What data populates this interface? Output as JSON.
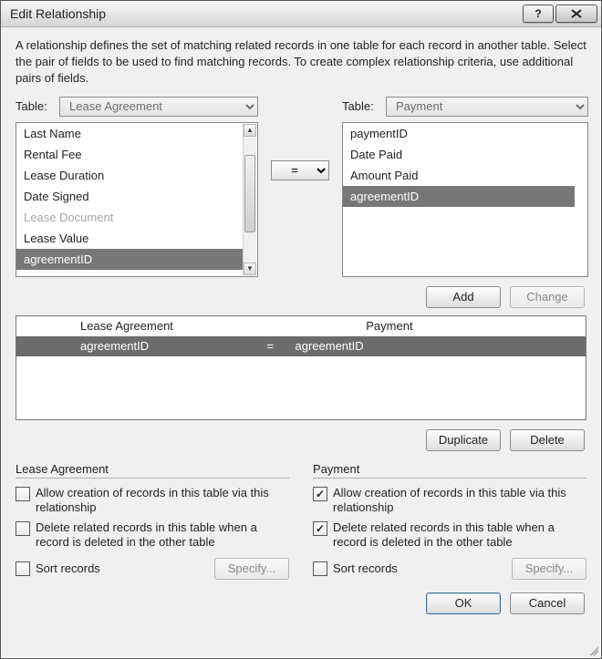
{
  "window": {
    "title": "Edit Relationship"
  },
  "intro": "A relationship defines the set of matching related records in one table for each record in another table. Select the pair of fields to be used to find matching records. To create complex relationship criteria, use additional pairs of fields.",
  "labels": {
    "table": "Table:"
  },
  "left": {
    "selected_table": "Lease Agreement",
    "fields": [
      "Last Name",
      "Rental Fee",
      "Lease Duration",
      "Date Signed",
      "Lease Document",
      "Lease Value",
      "agreementID"
    ],
    "disabled_index": 4,
    "selected_index": 6
  },
  "right": {
    "selected_table": "Payment",
    "fields": [
      "paymentID",
      "Date Paid",
      "Amount Paid",
      "agreementID"
    ],
    "selected_index": 3
  },
  "operator": "=",
  "buttons": {
    "add": "Add",
    "change": "Change",
    "duplicate": "Duplicate",
    "delete": "Delete",
    "specify": "Specify...",
    "ok": "OK",
    "cancel": "Cancel"
  },
  "pairs": {
    "header_left": "Lease Agreement",
    "header_right": "Payment",
    "row_left": "agreementID",
    "row_op": "=",
    "row_right": "agreementID"
  },
  "rules": {
    "left_title": "Lease Agreement",
    "right_title": "Payment",
    "allow_label": "Allow creation of records in this table via this relationship",
    "delete_label": "Delete related records in this table when a record is deleted in the other table",
    "sort_label": "Sort records",
    "left": {
      "allow": false,
      "delete": false,
      "sort": false
    },
    "right": {
      "allow": true,
      "delete": true,
      "sort": false
    }
  }
}
